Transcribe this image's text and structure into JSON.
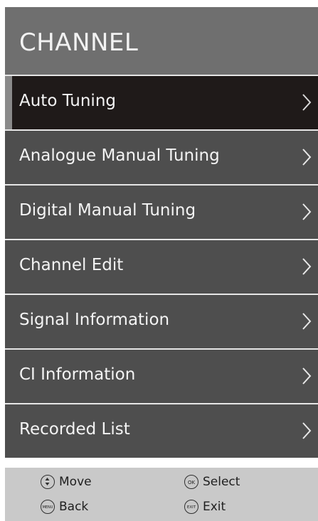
{
  "title": "CHANNEL",
  "items": [
    {
      "label": "Auto Tuning",
      "selected": true
    },
    {
      "label": "Analogue Manual Tuning",
      "selected": false
    },
    {
      "label": "Digital Manual Tuning",
      "selected": false
    },
    {
      "label": "Channel Edit",
      "selected": false
    },
    {
      "label": "Signal Information",
      "selected": false
    },
    {
      "label": "CI Information",
      "selected": false
    },
    {
      "label": "Recorded List",
      "selected": false
    }
  ],
  "footer": {
    "move": {
      "label": "Move",
      "icon": "up-down-arrows-icon"
    },
    "select": {
      "label": "Select",
      "icon": "ok-key-icon",
      "key": "OK"
    },
    "back": {
      "label": "Back",
      "icon": "menu-key-icon",
      "key": "MENU"
    },
    "exit": {
      "label": "Exit",
      "icon": "exit-key-icon",
      "key": "EXIT"
    }
  },
  "colors": {
    "header": "#6f6f6f",
    "item": "#4e4e4e",
    "selected": "#1f1a19",
    "footer": "#c9c9c9"
  }
}
